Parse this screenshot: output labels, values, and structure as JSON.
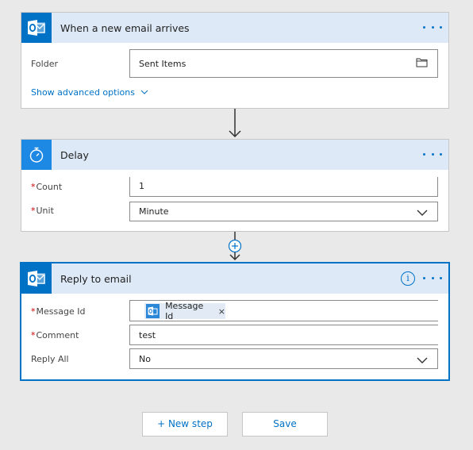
{
  "trigger": {
    "title": "When a new email arrives",
    "icon": "outlook-icon",
    "folder_label": "Folder",
    "folder_value": "Sent Items",
    "advanced_label": "Show advanced options"
  },
  "delay": {
    "title": "Delay",
    "icon": "timer-icon",
    "count_label": "Count",
    "count_value": "1",
    "unit_label": "Unit",
    "unit_value": "Minute"
  },
  "reply": {
    "title": "Reply to email",
    "icon": "outlook-icon",
    "message_id_label": "Message Id",
    "message_id_token": "Message Id",
    "token_remove": "×",
    "comment_label": "Comment",
    "comment_value": "test",
    "reply_all_label": "Reply All",
    "reply_all_value": "No"
  },
  "required_marker": "*",
  "actions": {
    "new_step_label": "+ New step",
    "save_label": "Save"
  },
  "colors": {
    "accent": "#0072c6",
    "header_bg": "#dde9f7",
    "required": "#cc0000"
  }
}
